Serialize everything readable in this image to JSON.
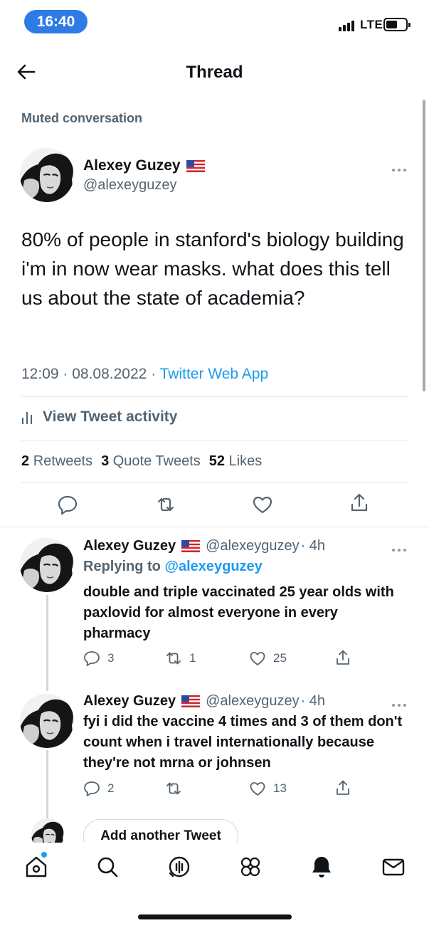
{
  "status_bar": {
    "time": "16:40",
    "network": "LTE"
  },
  "header": {
    "title": "Thread"
  },
  "muted_label": "Muted conversation",
  "main_tweet": {
    "author_name": "Alexey Guzey",
    "handle": "@alexeyguzey",
    "text": "80% of people in stanford's biology building i'm in now wear masks. what does this tell us about the state of academia?",
    "time": "12:09",
    "date": "08.08.2022",
    "source": "Twitter Web App",
    "activity_label": "View Tweet activity",
    "retweets_count": "2",
    "retweets_label": "Retweets",
    "quotes_count": "3",
    "quotes_label": "Quote Tweets",
    "likes_count": "52",
    "likes_label": "Likes"
  },
  "replies": [
    {
      "author_name": "Alexey Guzey",
      "handle": "@alexeyguzey",
      "age": "4h",
      "replying_prefix": "Replying to",
      "replying_to": "@alexeyguzey",
      "text": "double and triple vaccinated 25 year olds with paxlovid for almost everyone in every pharmacy",
      "reply_count": "3",
      "retweet_count": "1",
      "like_count": "25"
    },
    {
      "author_name": "Alexey Guzey",
      "handle": "@alexeyguzey",
      "age": "4h",
      "text": "fyi i did the vaccine 4 times and 3 of them don't count when i travel internationally because they're not mrna or johnsen",
      "reply_count": "2",
      "retweet_count": "",
      "like_count": "13"
    }
  ],
  "compose": {
    "add_label": "Add another Tweet"
  },
  "tabbar": {
    "items": [
      "home",
      "search",
      "spaces",
      "communities",
      "notifications",
      "messages"
    ]
  },
  "icons": [
    "back-arrow-icon",
    "flag-us-icon",
    "more-icon",
    "activity-icon",
    "reply-icon",
    "retweet-icon",
    "like-icon",
    "share-icon"
  ]
}
